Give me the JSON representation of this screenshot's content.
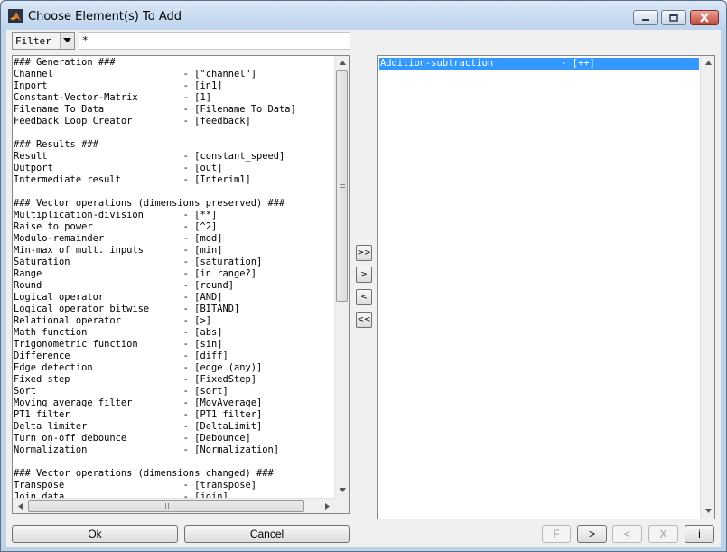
{
  "window": {
    "title": "Choose Element(s) To Add"
  },
  "filter": {
    "mode": "Filter",
    "value": "*"
  },
  "left_list": {
    "lines": [
      "### Generation ###",
      "Channel                       - [\"channel\"]",
      "Inport                        - [in1]",
      "Constant-Vector-Matrix        - [1]",
      "Filename To Data              - [Filename To Data]",
      "Feedback Loop Creator         - [feedback]",
      "",
      "### Results ###",
      "Result                        - [constant_speed]",
      "Outport                       - [out]",
      "Intermediate result           - [Interim1]",
      "",
      "### Vector operations (dimensions preserved) ###",
      "Multiplication-division       - [**]",
      "Raise to power                - [^2]",
      "Modulo-remainder              - [mod]",
      "Min-max of mult. inputs       - [min]",
      "Saturation                    - [saturation]",
      "Range                         - [in range?]",
      "Round                         - [round]",
      "Logical operator              - [AND]",
      "Logical operator bitwise      - [BITAND]",
      "Relational operator           - [>]",
      "Math function                 - [abs]",
      "Trigonometric function        - [sin]",
      "Difference                    - [diff]",
      "Edge detection                - [edge (any)]",
      "Fixed step                    - [FixedStep]",
      "Sort                          - [sort]",
      "Moving average filter         - [MovAverage]",
      "PT1 filter                    - [PT1 filter]",
      "Delta limiter                 - [DeltaLimit]",
      "Turn on-off debounce          - [Debounce]",
      "Normalization                 - [Normalization]",
      "",
      "### Vector operations (dimensions changed) ###",
      "Transpose                     - [transpose]",
      "Join data                     - [join]"
    ]
  },
  "transfer_buttons": {
    "add_all": ">>",
    "add": ">",
    "remove": "<",
    "remove_all": "<<"
  },
  "right_list": {
    "selected_item": "Addition-subtraction            - [++]"
  },
  "bottom": {
    "ok": "Ok",
    "cancel": "Cancel",
    "f": "F",
    "next": ">",
    "prev": "<",
    "x": "X",
    "info": "i"
  },
  "colors": {
    "selection": "#3399ff",
    "close_button": "#c34a3a"
  }
}
